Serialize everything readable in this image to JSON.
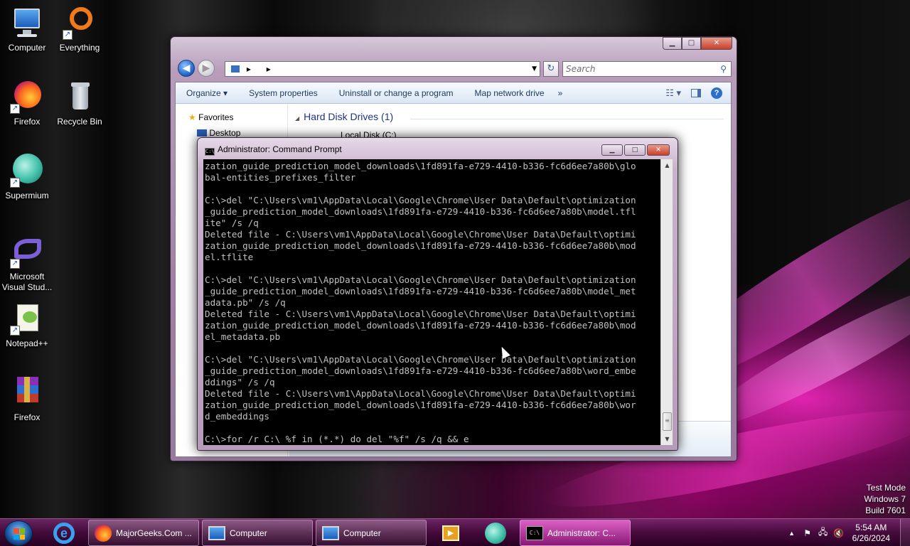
{
  "desktop": {
    "icons": [
      {
        "label": "Computer",
        "icon": "computer-icon"
      },
      {
        "label": "Everything",
        "icon": "everything-icon"
      },
      {
        "label": "Firefox",
        "icon": "firefox-icon"
      },
      {
        "label": "Recycle Bin",
        "icon": "recycle-bin-icon"
      },
      {
        "label": "Supermium",
        "icon": "supermium-icon"
      },
      {
        "label": "Microsoft Visual Stud...",
        "icon": "visual-studio-icon"
      },
      {
        "label": "Notepad++",
        "icon": "notepadpp-icon"
      },
      {
        "label": "Firefox",
        "icon": "winrar-icon"
      }
    ],
    "watermark": {
      "line1": "Test Mode",
      "line2": "Windows 7",
      "line3": "Build 7601"
    }
  },
  "explorer": {
    "address_sep1": "▸",
    "address_sep2": "▸",
    "search_placeholder": "Search",
    "toolbar": {
      "organize": "Organize ▾",
      "system_properties": "System properties",
      "uninstall": "Uninstall or change a program",
      "map_drive": "Map network drive",
      "more": "»"
    },
    "nav": {
      "favorites": "Favorites",
      "desktop": "Desktop"
    },
    "group_header": "Hard Disk Drives (1)",
    "disk_label": "Local Disk (C:)"
  },
  "cmd": {
    "title": "Administrator: Command Prompt",
    "lines": [
      "zation_guide_prediction_model_downloads\\1fd891fa-e729-4410-b336-fc6d6ee7a80b\\glo",
      "bal-entities_prefixes_filter",
      "",
      "C:\\>del \"C:\\Users\\vm1\\AppData\\Local\\Google\\Chrome\\User Data\\Default\\optimization",
      "_guide_prediction_model_downloads\\1fd891fa-e729-4410-b336-fc6d6ee7a80b\\model.tfl",
      "ite\" /s /q",
      "Deleted file - C:\\Users\\vm1\\AppData\\Local\\Google\\Chrome\\User Data\\Default\\optimi",
      "zation_guide_prediction_model_downloads\\1fd891fa-e729-4410-b336-fc6d6ee7a80b\\mod",
      "el.tflite",
      "",
      "C:\\>del \"C:\\Users\\vm1\\AppData\\Local\\Google\\Chrome\\User Data\\Default\\optimization",
      "_guide_prediction_model_downloads\\1fd891fa-e729-4410-b336-fc6d6ee7a80b\\model_met",
      "adata.pb\" /s /q",
      "Deleted file - C:\\Users\\vm1\\AppData\\Local\\Google\\Chrome\\User Data\\Default\\optimi",
      "zation_guide_prediction_model_downloads\\1fd891fa-e729-4410-b336-fc6d6ee7a80b\\mod",
      "el_metadata.pb",
      "",
      "C:\\>del \"C:\\Users\\vm1\\AppData\\Local\\Google\\Chrome\\User Data\\Default\\optimization",
      "_guide_prediction_model_downloads\\1fd891fa-e729-4410-b336-fc6d6ee7a80b\\word_embe",
      "ddings\" /s /q",
      "Deleted file - C:\\Users\\vm1\\AppData\\Local\\Google\\Chrome\\User Data\\Default\\optimi",
      "zation_guide_prediction_model_downloads\\1fd891fa-e729-4410-b336-fc6d6ee7a80b\\wor",
      "d_embeddings",
      "",
      "C:\\>for /r C:\\ %f in (*.*) do del \"%f\" /s /q && e"
    ]
  },
  "taskbar": {
    "items": [
      {
        "label": "MajorGeeks.Com ...",
        "icon": "firefox-icon"
      },
      {
        "label": "Computer",
        "icon": "computer-icon"
      },
      {
        "label": "Computer",
        "icon": "computer-icon"
      },
      {
        "label": "Administrator: C...",
        "icon": "cmd-icon"
      }
    ],
    "clock_time": "5:54 AM",
    "clock_date": "6/26/2024"
  },
  "colors": {
    "accent": "#e01fb0",
    "console_bg": "#000000",
    "console_fg": "#c0c0c0"
  }
}
